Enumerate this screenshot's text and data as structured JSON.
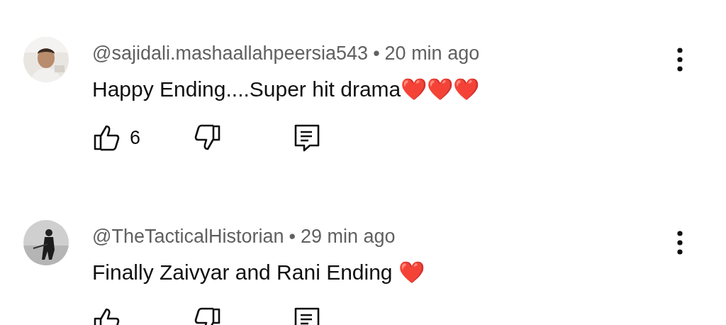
{
  "comments": [
    {
      "author": "@sajidali.mashaallahpeersia543",
      "separator": "•",
      "time": "20 min ago",
      "text": "Happy Ending....Super hit drama❤️❤️❤️",
      "likes": "6"
    },
    {
      "author": "@TheTacticalHistorian",
      "separator": "•",
      "time": "29 min ago",
      "text": "Finally Zaivyar and Rani Ending ❤️"
    }
  ]
}
